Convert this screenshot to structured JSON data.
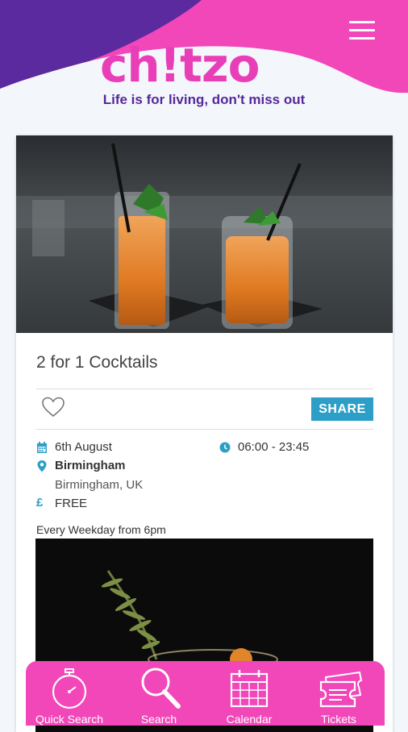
{
  "header": {
    "logo_text": "ch!tzo",
    "tagline": "Life is for living, don't miss out"
  },
  "event": {
    "title": "2 for 1 Cocktails",
    "share_label": "SHARE",
    "date": "6th August",
    "time": "06:00 - 23:45",
    "venue": "Birmingham",
    "address": "Birmingham, UK",
    "price": "FREE",
    "description": "Every Weekday from 6pm"
  },
  "nav": {
    "items": [
      {
        "label": "Quick Search",
        "icon": "stopwatch-icon"
      },
      {
        "label": "Search",
        "icon": "magnifier-icon"
      },
      {
        "label": "Calendar",
        "icon": "calendar-icon"
      },
      {
        "label": "Tickets",
        "icon": "tickets-icon"
      }
    ]
  },
  "colors": {
    "brand_pink": "#f147b9",
    "brand_purple": "#55289a",
    "accent_teal": "#2d9fc6"
  }
}
